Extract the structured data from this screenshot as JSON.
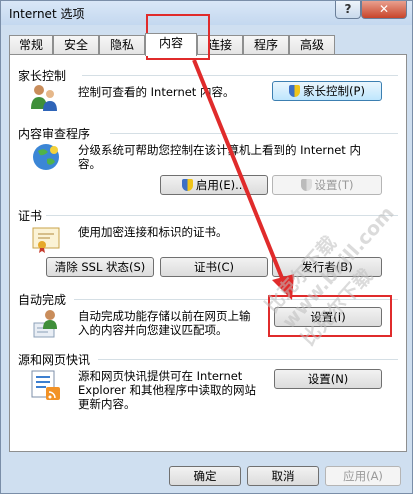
{
  "window": {
    "title": "Internet 选项",
    "help_label": "?",
    "close_label": "✕"
  },
  "tabs": [
    {
      "label": "常规",
      "active": false
    },
    {
      "label": "安全",
      "active": false
    },
    {
      "label": "隐私",
      "active": false
    },
    {
      "label": "内容",
      "active": true
    },
    {
      "label": "连接",
      "active": false
    },
    {
      "label": "程序",
      "active": false
    },
    {
      "label": "高级",
      "active": false
    }
  ],
  "sections": {
    "parental": {
      "title": "家长控制",
      "description": "控制可查看的 Internet 内容。",
      "button": "家长控制(P)",
      "icon": "family-users-icon"
    },
    "advisor": {
      "title": "内容审查程序",
      "description_line1": "分级系统可帮助您控制在该计算机上看到的 Internet 内",
      "description_line2": "容。",
      "enable_button": "启用(E)...",
      "settings_button": "设置(T)",
      "icon": "globe-icon"
    },
    "certificates": {
      "title": "证书",
      "description": "使用加密连接和标识的证书。",
      "clear_ssl_button": "清除 SSL 状态(S)",
      "certificates_button": "证书(C)",
      "publishers_button": "发行者(B)",
      "icon": "certificate-icon"
    },
    "autocomplete": {
      "title": "自动完成",
      "description_line1": "自动完成功能存储以前在网页上输",
      "description_line2": "入的内容并向您建议匹配项。",
      "settings_button": "设置(I)",
      "icon": "autocomplete-user-icon"
    },
    "feeds": {
      "title": "源和网页快讯",
      "description_line1": "源和网页快讯提供可在 Internet",
      "description_line2": "Explorer 和其他程序中读取的网站",
      "description_line3": "更新内容。",
      "settings_button": "设置(N)",
      "icon": "rss-feed-icon"
    }
  },
  "footer": {
    "ok_label": "确定",
    "cancel_label": "取消",
    "apply_label": "应用(A)"
  },
  "watermark": {
    "line1": "比克尔下载",
    "line2": "www.bkill.com",
    "line3": "比克尔下载"
  },
  "colors": {
    "highlight": "#e02b2b",
    "focus_button": "#bee6fd"
  }
}
